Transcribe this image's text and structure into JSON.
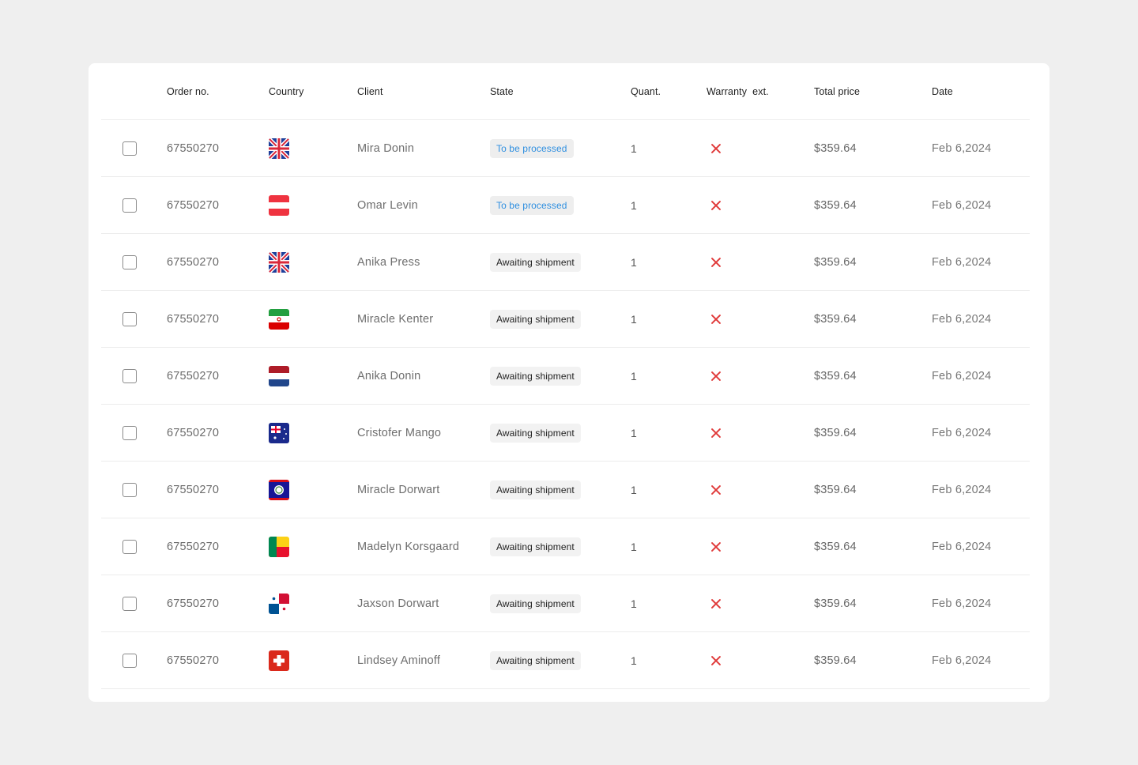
{
  "colors": {
    "background": "#efefef",
    "card": "#ffffff",
    "badge_blue_text": "#2f8fe0",
    "warranty_x": "#e03a3a"
  },
  "table": {
    "columns": {
      "order": "Order no.",
      "country": "Country",
      "client": "Client",
      "state": "State",
      "qty": "Quant.",
      "warranty": "Warranty  ext.",
      "price": "Total price",
      "date": "Date"
    },
    "rows": [
      {
        "order": "67550270",
        "country_flag": "united-kingdom",
        "client": "Mira Donin",
        "state": "To be processed",
        "state_style": "blue",
        "qty": "1",
        "warranty_icon": "x-icon",
        "price": "$359.64",
        "date": "Feb 6,2024",
        "checked": false
      },
      {
        "order": "67550270",
        "country_flag": "austria",
        "client": "Omar Levin",
        "state": "To be processed",
        "state_style": "blue",
        "qty": "1",
        "warranty_icon": "x-icon",
        "price": "$359.64",
        "date": "Feb 6,2024",
        "checked": false
      },
      {
        "order": "67550270",
        "country_flag": "united-kingdom",
        "client": "Anika Press",
        "state": "Awaiting shipment",
        "state_style": "gray",
        "qty": "1",
        "warranty_icon": "x-icon",
        "price": "$359.64",
        "date": "Feb 6,2024",
        "checked": false
      },
      {
        "order": "67550270",
        "country_flag": "iran",
        "client": "Miracle Kenter",
        "state": "Awaiting shipment",
        "state_style": "gray",
        "qty": "1",
        "warranty_icon": "x-icon",
        "price": "$359.64",
        "date": "Feb 6,2024",
        "checked": false
      },
      {
        "order": "67550270",
        "country_flag": "netherlands",
        "client": "Anika Donin",
        "state": "Awaiting shipment",
        "state_style": "gray",
        "qty": "1",
        "warranty_icon": "x-icon",
        "price": "$359.64",
        "date": "Feb 6,2024",
        "checked": false
      },
      {
        "order": "67550270",
        "country_flag": "australia",
        "client": "Cristofer Mango",
        "state": "Awaiting shipment",
        "state_style": "gray",
        "qty": "1",
        "warranty_icon": "x-icon",
        "price": "$359.64",
        "date": "Feb 6,2024",
        "checked": false
      },
      {
        "order": "67550270",
        "country_flag": "belize",
        "client": "Miracle Dorwart",
        "state": "Awaiting shipment",
        "state_style": "gray",
        "qty": "1",
        "warranty_icon": "x-icon",
        "price": "$359.64",
        "date": "Feb 6,2024",
        "checked": false
      },
      {
        "order": "67550270",
        "country_flag": "benin",
        "client": "Madelyn Korsgaard",
        "state": "Awaiting shipment",
        "state_style": "gray",
        "qty": "1",
        "warranty_icon": "x-icon",
        "price": "$359.64",
        "date": "Feb 6,2024",
        "checked": false
      },
      {
        "order": "67550270",
        "country_flag": "panama",
        "client": "Jaxson Dorwart",
        "state": "Awaiting shipment",
        "state_style": "gray",
        "qty": "1",
        "warranty_icon": "x-icon",
        "price": "$359.64",
        "date": "Feb 6,2024",
        "checked": false
      },
      {
        "order": "67550270",
        "country_flag": "switzerland",
        "client": "Lindsey Aminoff",
        "state": "Awaiting shipment",
        "state_style": "gray",
        "qty": "1",
        "warranty_icon": "x-icon",
        "price": "$359.64",
        "date": "Feb 6,2024",
        "checked": false
      }
    ]
  }
}
